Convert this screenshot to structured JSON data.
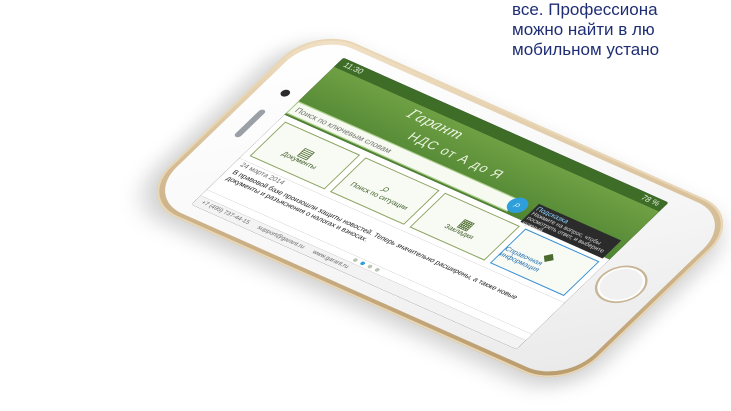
{
  "caption": {
    "lines": [
      "все. Профессиона",
      "можно найти в лю",
      "мобильном устано"
    ]
  },
  "phone": {
    "status": {
      "time": "11:30",
      "battery": "78 %"
    },
    "brand": "Гарант",
    "hero_title": "НДС от А до Я",
    "search": {
      "placeholder": "Поиск по ключевым словам"
    },
    "tip": {
      "title": "Подсказка",
      "text": "Нажмите на вопрос, чтобы посмотреть ответ, и выберите нужный."
    },
    "tiles": [
      {
        "icon": "document-icon",
        "label": "Документы"
      },
      {
        "icon": "search-icon",
        "label": "Поиск по ситуации"
      },
      {
        "icon": "calculator-icon",
        "label": "Закладки"
      },
      {
        "icon": "reference-icon",
        "label": "Справочная информация"
      }
    ],
    "news": {
      "date": "24 марта 2014",
      "text": "В правовой базе произошли защиты новостей. Теперь значительно расширены, а также новые документы и разъяснения о налогах и взносах."
    },
    "footer": {
      "phone": "+7 (495) 737-44-15",
      "email": "support@garant.ru",
      "site": "www.garant.ru"
    }
  }
}
